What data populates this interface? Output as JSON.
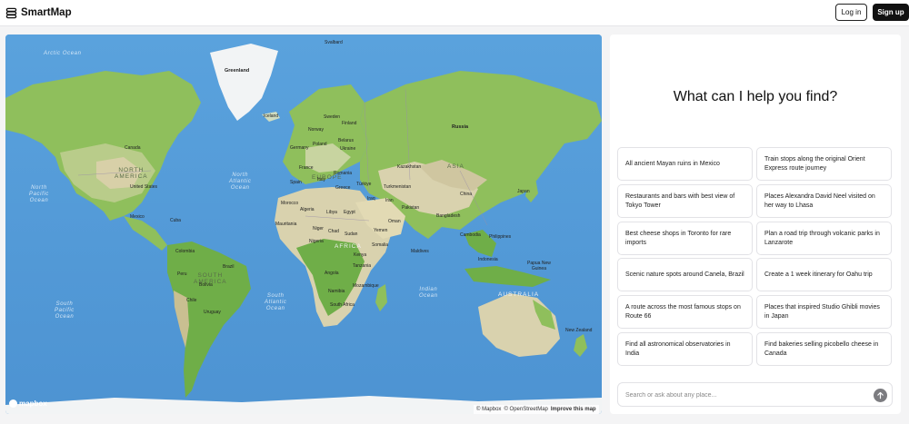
{
  "app": {
    "name": "SmartMap"
  },
  "header": {
    "login_label": "Log in",
    "signup_label": "Sign up"
  },
  "panel": {
    "heading": "What can I help you find?",
    "suggestions": [
      "All ancient Mayan ruins in Mexico",
      "Train stops along the original Orient Express route journey",
      "Restaurants and bars with best view of Tokyo Tower",
      "Places Alexandra David Neel visited on her way to Lhasa",
      "Best cheese shops in Toronto for rare imports",
      "Plan a road trip through volcanic parks in Lanzarote",
      "Scenic nature spots around Canela, Brazil",
      "Create a 1 week itinerary for Oahu trip",
      "A route across the most famous stops on Route 66",
      "Places that inspired Studio Ghibli movies in Japan",
      "Find all astronomical observatories in India",
      "Find bakeries selling picobello cheese in Canada"
    ],
    "search_placeholder": "Search or ask about any place..."
  },
  "map": {
    "attribution": {
      "mapbox": "© Mapbox",
      "osm": "© OpenStreetMap",
      "improve": "Improve this map"
    },
    "logo": "mapbox",
    "oceans": {
      "arctic": "Arctic Ocean",
      "north_pacific_1": "North",
      "north_pacific_2": "Pacific",
      "north_pacific_3": "Ocean",
      "north_atlantic_1": "North",
      "north_atlantic_2": "Atlantic",
      "north_atlantic_3": "Ocean",
      "south_pacific_1": "South",
      "south_pacific_2": "Pacific",
      "south_pacific_3": "Ocean",
      "south_atlantic_1": "South",
      "south_atlantic_2": "Atlantic",
      "south_atlantic_3": "Ocean",
      "indian_1": "Indian",
      "indian_2": "Ocean"
    },
    "continents": {
      "north_america_1": "NORTH",
      "north_america_2": "AMERICA",
      "south_america_1": "SOUTH",
      "south_america_2": "AMERICA",
      "europe": "EUROPE",
      "asia": "ASIA",
      "africa": "AFRICA",
      "australia": "AUSTRALIA"
    },
    "places": {
      "svalbard": "Svalbard",
      "greenland": "Greenland",
      "iceland": "Iceland",
      "norway": "Norway",
      "sweden": "Sweden",
      "finland": "Finland",
      "russia": "Russia",
      "belarus": "Belarus",
      "ukraine": "Ukraine",
      "poland": "Poland",
      "germany": "Germany",
      "france": "France",
      "spain": "Spain",
      "italy": "Italy",
      "romania": "Romania",
      "greece": "Greece",
      "turkey": "Türkiye",
      "kazakhstan": "Kazakhstan",
      "turkmenistan": "Turkmenistan",
      "iran": "Iran",
      "iraq": "Iraq",
      "pakistan": "Pakistan",
      "china": "China",
      "japan": "Japan",
      "bangladesh": "Bangladesh",
      "cambodia": "Cambodia",
      "philippines": "Philippines",
      "indonesia": "Indonesia",
      "png_1": "Papua New",
      "png_2": "Guinea",
      "canada": "Canada",
      "united_states": "United States",
      "mexico": "Mexico",
      "cuba": "Cuba",
      "colombia": "Colombia",
      "peru": "Peru",
      "brazil": "Brazil",
      "bolivia": "Bolivia",
      "chile": "Chile",
      "uruguay": "Uruguay",
      "morocco": "Morocco",
      "algeria": "Algeria",
      "libya": "Libya",
      "egypt": "Egypt",
      "mauritania": "Mauritania",
      "niger": "Niger",
      "chad": "Chad",
      "sudan": "Sudan",
      "nigeria": "Nigeria",
      "oman": "Oman",
      "yemen": "Yemen",
      "somalia": "Somalia",
      "kenya": "Kenya",
      "tanzania": "Tanzania",
      "angola": "Angola",
      "namibia": "Namibia",
      "mozambique": "Mozambique",
      "south_africa": "South Africa",
      "maldives": "Maldives",
      "new_zealand": "New Zealand"
    }
  }
}
